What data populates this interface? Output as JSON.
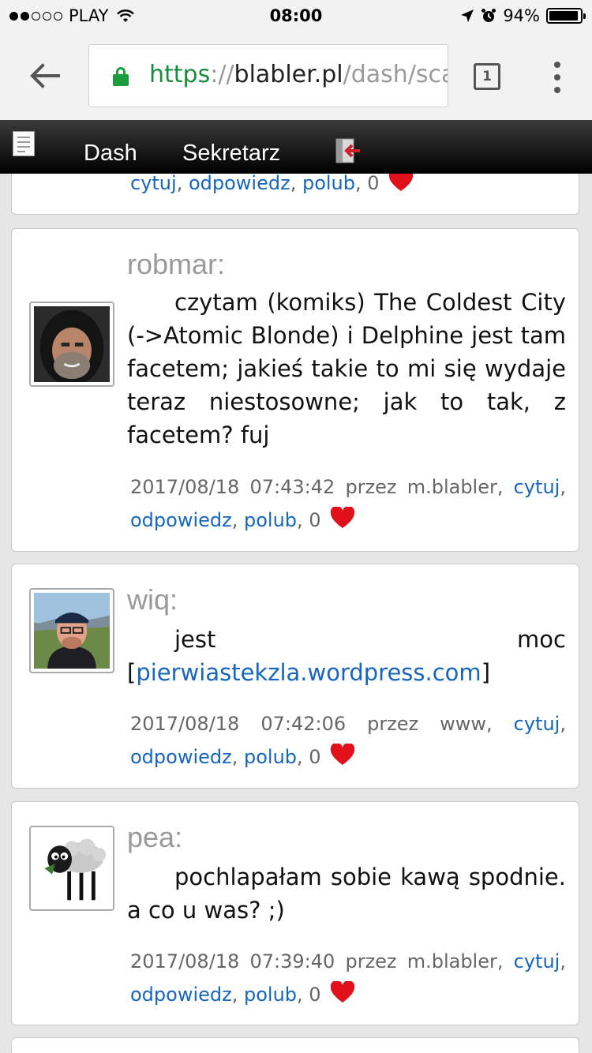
{
  "status_bar": {
    "carrier": "PLAY",
    "time": "08:00",
    "battery": "94%",
    "battery_level": 0.94,
    "signal_bars_filled": 2,
    "signal_bars_total": 5,
    "icons": [
      "wifi-icon",
      "location-arrow-icon",
      "alarm-icon",
      "battery-icon"
    ]
  },
  "browser": {
    "url_scheme": "https",
    "url_sep": "://",
    "url_host": "blabler.pl",
    "url_path": "/dash/sca",
    "tab_count": "1",
    "colors": {
      "secure": "#1a8d3c",
      "link": "#1666c0"
    }
  },
  "site_nav": {
    "items": [
      {
        "label": "Dash"
      },
      {
        "label": "Sekretarz"
      }
    ]
  },
  "posts": [
    {
      "author": "",
      "message": "",
      "cytuj": "cytuj",
      "odpowiedz": "odpowiedz",
      "polub": "polub",
      "likes": "0"
    },
    {
      "author": "robmar:",
      "message": "czytam (komiks) The Coldest City (->Atomic Blonde) i Delphine jest tam facetem; jakieś takie to mi się wydaje teraz niestosowne; jak to tak, z facetem? fuj",
      "date": "2017/08/18",
      "time": "07:43:42",
      "via_label": "przez",
      "via": "m.blabler",
      "cytuj": "cytuj",
      "odpowiedz": "odpowiedz",
      "polub": "polub",
      "likes": "0"
    },
    {
      "author": "wiq:",
      "message_pre": "jest moc [",
      "message_link": "pierwiastekzla.wordpress.com",
      "message_post": "]",
      "date": "2017/08/18",
      "time": "07:42:06",
      "via_label": "przez",
      "via": "www",
      "cytuj": "cytuj",
      "odpowiedz": "odpowiedz",
      "polub": "polub",
      "likes": "0"
    },
    {
      "author": "pea:",
      "message": "pochlapałam sobie kawą spodnie. a co u was? ;)",
      "date": "2017/08/18",
      "time": "07:39:40",
      "via_label": "przez",
      "via": "m.blabler",
      "cytuj": "cytuj",
      "odpowiedz": "odpowiedz",
      "polub": "polub",
      "likes": "0"
    }
  ]
}
